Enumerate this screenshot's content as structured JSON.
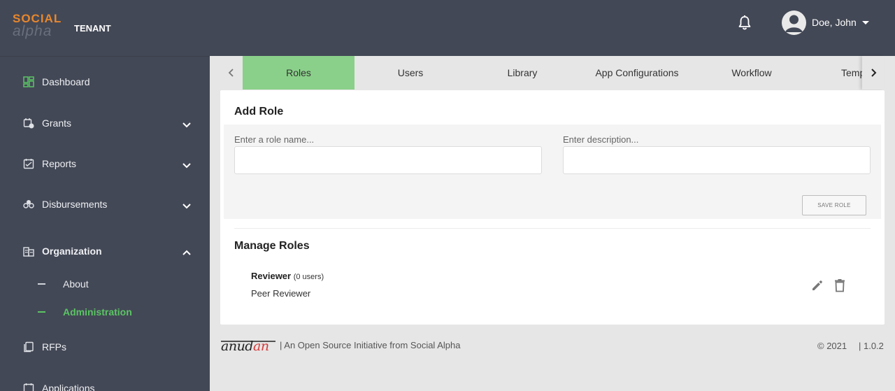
{
  "app": {
    "logo_line1": "SOCIAL",
    "logo_line2": "alpha",
    "tenant": "TENANT"
  },
  "header": {
    "notification_icon": "bell-icon",
    "user_name": "Doe, John",
    "avatar_icon": "user-avatar-icon"
  },
  "sidebar": {
    "items": [
      {
        "label": "Dashboard",
        "icon": "dashboard-icon",
        "expandable": false
      },
      {
        "label": "Grants",
        "icon": "grants-icon",
        "expandable": true,
        "expanded": false
      },
      {
        "label": "Reports",
        "icon": "reports-icon",
        "expandable": true,
        "expanded": false
      },
      {
        "label": "Disbursements",
        "icon": "disbursements-icon",
        "expandable": true,
        "expanded": false
      },
      {
        "label": "Organization",
        "icon": "organization-icon",
        "expandable": true,
        "expanded": true
      },
      {
        "label": "RFPs",
        "icon": "rfps-icon",
        "expandable": false
      },
      {
        "label": "Applications",
        "icon": "applications-icon",
        "expandable": false
      }
    ],
    "organization_subitems": [
      {
        "label": "About",
        "active": false
      },
      {
        "label": "Administration",
        "active": true
      }
    ]
  },
  "tabs": [
    {
      "label": "Roles",
      "active": true
    },
    {
      "label": "Users",
      "active": false
    },
    {
      "label": "Library",
      "active": false
    },
    {
      "label": "App Configurations",
      "active": false
    },
    {
      "label": "Workflow",
      "active": false
    },
    {
      "label": "Templates",
      "active": false
    }
  ],
  "add_role": {
    "title": "Add Role",
    "name_placeholder": "Enter a role name...",
    "name_value": "",
    "description_placeholder": "Enter description...",
    "description_value": "",
    "save_label": "SAVE ROLE"
  },
  "manage_roles": {
    "title": "Manage Roles",
    "roles": [
      {
        "name": "Reviewer",
        "count": "(0 users)",
        "description": "Peer Reviewer"
      }
    ]
  },
  "footer": {
    "brand": "anudan",
    "tagline": "| An Open Source Initiative from Social Alpha",
    "copyright": "© 2021",
    "version": "| 1.0.2"
  },
  "colors": {
    "header_bg": "#434856",
    "accent_orange": "#e8872c",
    "active_green": "#5bc464",
    "active_tab": "#8ad08a",
    "content_bg": "#e6e6e6",
    "footer_brand_red": "#d63a3a"
  }
}
